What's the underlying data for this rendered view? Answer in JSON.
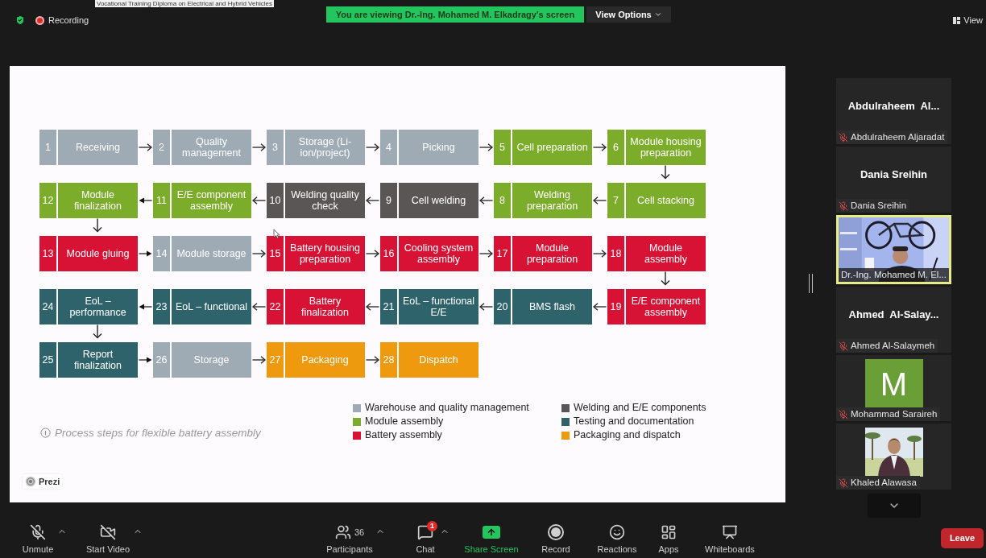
{
  "top_line": "Vocational Training Diploma on Electrical and Hybrid Vehicles",
  "status": {
    "recording": "Recording"
  },
  "banner": "You are viewing Dr.-Ing. Mohamed M. Elkadragy's screen",
  "view_options": "View Options",
  "view_button": "View",
  "slide": {
    "rows": [
      [
        {
          "number": "1",
          "label": "Receiving",
          "color": "#9eaab4"
        },
        {
          "number": "2",
          "label": "Quality management",
          "color": "#9eaab4"
        },
        {
          "number": "3",
          "label": "Storage (Li-ion/project)",
          "color": "#9eaab4"
        },
        {
          "number": "4",
          "label": "Picking",
          "color": "#9eaab4"
        },
        {
          "number": "5",
          "label": "Cell preparation",
          "color": "#7cad2a"
        },
        {
          "number": "6",
          "label": "Module housing preparation",
          "color": "#7cad2a"
        }
      ],
      [
        {
          "number": "12",
          "label": "Module finalization",
          "color": "#7cad2a"
        },
        {
          "number": "11",
          "label": "E/E component assembly",
          "color": "#7cad2a"
        },
        {
          "number": "10",
          "label": "Welding quality check",
          "color": "#5a5655"
        },
        {
          "number": "9",
          "label": "Cell welding",
          "color": "#5a5655"
        },
        {
          "number": "8",
          "label": "Welding preparation",
          "color": "#7cad2a"
        },
        {
          "number": "7",
          "label": "Cell stacking",
          "color": "#7cad2a"
        }
      ],
      [
        {
          "number": "13",
          "label": "Module gluing",
          "color": "#d81234"
        },
        {
          "number": "14",
          "label": "Module storage",
          "color": "#9eaab4"
        },
        {
          "number": "15",
          "label": "Battery housing preparation",
          "color": "#d81234"
        },
        {
          "number": "16",
          "label": "Cooling system assembly",
          "color": "#d81234"
        },
        {
          "number": "17",
          "label": "Module preparation",
          "color": "#d81234"
        },
        {
          "number": "18",
          "label": "Module assembly",
          "color": "#d81234"
        }
      ],
      [
        {
          "number": "24",
          "label": "EoL – performance",
          "color": "#2f636b"
        },
        {
          "number": "23",
          "label": "EoL – functional",
          "color": "#2f636b"
        },
        {
          "number": "22",
          "label": "Battery finalization",
          "color": "#d81234"
        },
        {
          "number": "21",
          "label": "EoL – functional E/E",
          "color": "#2f636b"
        },
        {
          "number": "20",
          "label": "BMS flash",
          "color": "#2f636b"
        },
        {
          "number": "19",
          "label": "E/E component assembly",
          "color": "#d81234"
        }
      ],
      [
        {
          "number": "25",
          "label": "Report finalization",
          "color": "#2f636b"
        },
        {
          "number": "26",
          "label": "Storage",
          "color": "#9eaab4"
        },
        {
          "number": "27",
          "label": "Packaging",
          "color": "#ef9a0e"
        },
        {
          "number": "28",
          "label": "Dispatch",
          "color": "#ef9a0e"
        }
      ]
    ],
    "legend": [
      {
        "label": "Warehouse and quality management",
        "color": "#9eaab4"
      },
      {
        "label": "Module assembly",
        "color": "#7cad2a"
      },
      {
        "label": "Battery assembly",
        "color": "#d81234"
      },
      {
        "label": "Welding and E/E components",
        "color": "#5a5655"
      },
      {
        "label": "Testing and documentation",
        "color": "#2f636b"
      },
      {
        "label": "Packaging and dispatch",
        "color": "#ef9a0e"
      }
    ],
    "caption": "Process steps for flexible battery assembly",
    "logo": "Prezi"
  },
  "participants": [
    {
      "kind": "name",
      "title": "Abdulraheem  Al...",
      "name": "Abdulraheem Aljaradat",
      "muted": true,
      "selected": false
    },
    {
      "kind": "name",
      "title": "Dania Sreihin",
      "name": "Dania Sreihin",
      "muted": true,
      "selected": false
    },
    {
      "kind": "video",
      "name": "Dr.-Ing. Mohamed M. El...",
      "muted": false,
      "selected": true
    },
    {
      "kind": "name",
      "title": "Ahmed  Al-Salay...",
      "name": "Ahmed Al-Salaymeh",
      "muted": true,
      "selected": false
    },
    {
      "kind": "avatar",
      "initial": "M",
      "name": "Mohammad Saraireh",
      "muted": true,
      "selected": false
    },
    {
      "name": "Khaled Alawasa",
      "muted": true,
      "selected": false
    }
  ],
  "toolbar": [
    {
      "kind": "mic",
      "label": "Unmute",
      "caret": true
    },
    {
      "kind": "video",
      "label": "Start Video",
      "caret": true
    },
    {
      "kind": "participants",
      "label": "Participants",
      "count": "36",
      "caret": true
    },
    {
      "kind": "chat",
      "label": "Chat",
      "badge": "1",
      "caret": true
    },
    {
      "kind": "share",
      "label": "Share Screen",
      "caret": false
    },
    {
      "kind": "record",
      "label": "Record",
      "caret": false
    },
    {
      "kind": "reactions",
      "label": "Reactions",
      "caret": false
    },
    {
      "kind": "apps",
      "label": "Apps",
      "caret": false
    },
    {
      "kind": "whiteboards",
      "label": "Whiteboards",
      "caret": false
    }
  ],
  "leave": "Leave"
}
